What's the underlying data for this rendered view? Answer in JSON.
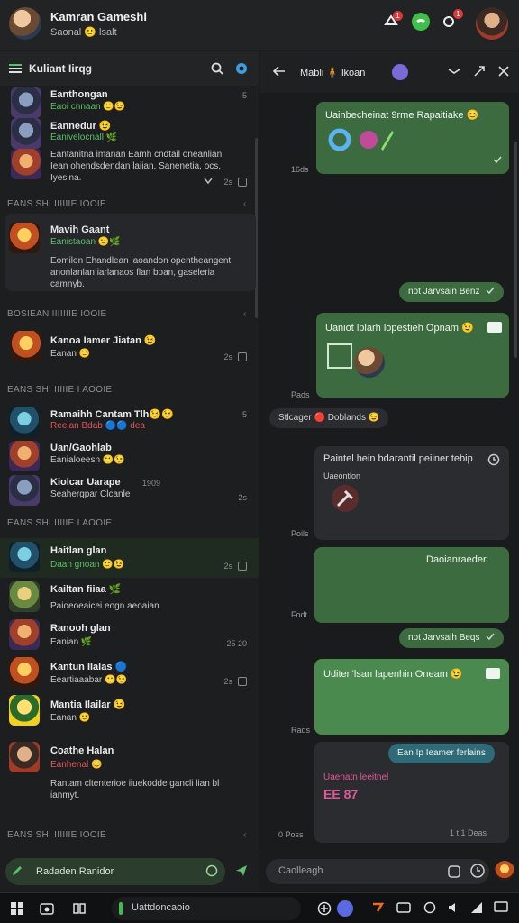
{
  "topbar": {
    "title": "Kamran Gameshi",
    "subtitle": "Saonal 🙂 lsalt",
    "badges": [
      "1",
      "1"
    ]
  },
  "left_panel": {
    "header_title": "Kuliant Iirqg",
    "sections": [
      "EANS SHI IIIIIIE IOOIE",
      "BOSIEAN IIIIIIIE IOOIE",
      "EANS SHI IIIIIE I AOOIE",
      "EANS SHI IIIIIE I AOOIE",
      "EANS SHI IIIIIIE IOOIE"
    ],
    "chats": [
      {
        "name": "Eanthongan",
        "sub": "Eaoi cnnaan 🙂😉",
        "meta": "5"
      },
      {
        "name": "Eannedur 😉",
        "sub": "Eanivelocnall 🌿",
        "meta": ""
      },
      {
        "name": "",
        "sub": "",
        "msg": "Eantanitna imanan Eamh cndtail oneanlian Iean ohendsdendan laiian, Sanenetia, ocs, Iyesina.",
        "meta": "2s"
      },
      {
        "name": "Mavih Gaant",
        "sub": "Eanistaoan 🙂🌿",
        "msg": "Eomilon Ehandlean iaoandon opentheangent anonlanlan iarlanaos flan boan, gaseleria camnyb.",
        "meta": ""
      },
      {
        "name": "Kanoa Iamer Jiatan 😉",
        "sub": "Eanan 🙂",
        "meta": "2s"
      },
      {
        "name": "Ramaihh Cantam Tlh😉😉",
        "sub": "Reelan Bdab 🔵🔵 dea",
        "meta": "5"
      },
      {
        "name": "Uan/Gaohlab",
        "sub": "Eanialoeesn 🙂😉",
        "meta": ""
      },
      {
        "name": "Kiolcar Uarape",
        "sub": "Seahergpar Clcanle",
        "meta": "2s",
        "meta_top": "1909"
      },
      {
        "name": "Haitlan glan",
        "sub": "Daan gnoan 🙂😉",
        "meta": "2s"
      },
      {
        "name": "Kailtan fiiaa 🌿",
        "sub": "Paioeoeaicei eogn aeoaian.",
        "meta": ""
      },
      {
        "name": "Ranooh glan",
        "sub": "Eanian 🌿",
        "meta": "25 20"
      },
      {
        "name": "Kantun Ilalas 🔵",
        "sub": "Eeartiaaabar 🙂😉",
        "meta": "2s"
      },
      {
        "name": "Mantia Ilailar 😉",
        "sub": "Eanan 🙂",
        "meta": ""
      },
      {
        "name": "Coathe Halan",
        "sub": "Eanhenal 😊",
        "msg": "Rantam cltenterioe iiuekodde gancli lian bl ianmyt.",
        "meta": ""
      }
    ],
    "search_placeholder": "Radaden Ranidor"
  },
  "right_panel": {
    "header": "Mabli 🧍 lkoan",
    "messages": [
      {
        "text": "Uainbecheinat 9rme Rapaitiake 😊",
        "time": "16ds"
      },
      {
        "text": "not Jarvsain Benz",
        "type": "pill"
      },
      {
        "text": "Uaniot lplarh lopestieh Opnam 😉",
        "time": "Pads"
      },
      {
        "text": "Stlcager 🔴 Doblands 😉",
        "type": "label"
      },
      {
        "text": "Paintel hein bdarantil peiiner tebip",
        "sub": "Uaeontlon",
        "time": "Poils"
      },
      {
        "text": "Daoianraeder",
        "time": "Fodt"
      },
      {
        "text": "not Jarvsaih Beqs",
        "type": "pill"
      },
      {
        "text": "Uditen'lsan lapenhin Oneam 😉",
        "time": "Rads"
      },
      {
        "text": "Ean Ip Ieamer ferlains",
        "type": "pill-blue"
      },
      {
        "text": "Uaenatn leeitnel",
        "sub": "EE 87",
        "time": "0 Poss",
        "time2": "1 t 1 Deas"
      }
    ],
    "input_placeholder": "Caolleagh"
  },
  "taskbar": {
    "search_text": "Uattdoncaoio"
  },
  "colors": {
    "accent_green": "#3d6b40",
    "online_green": "#5cbf6a",
    "alert_red": "#d93a3a"
  }
}
